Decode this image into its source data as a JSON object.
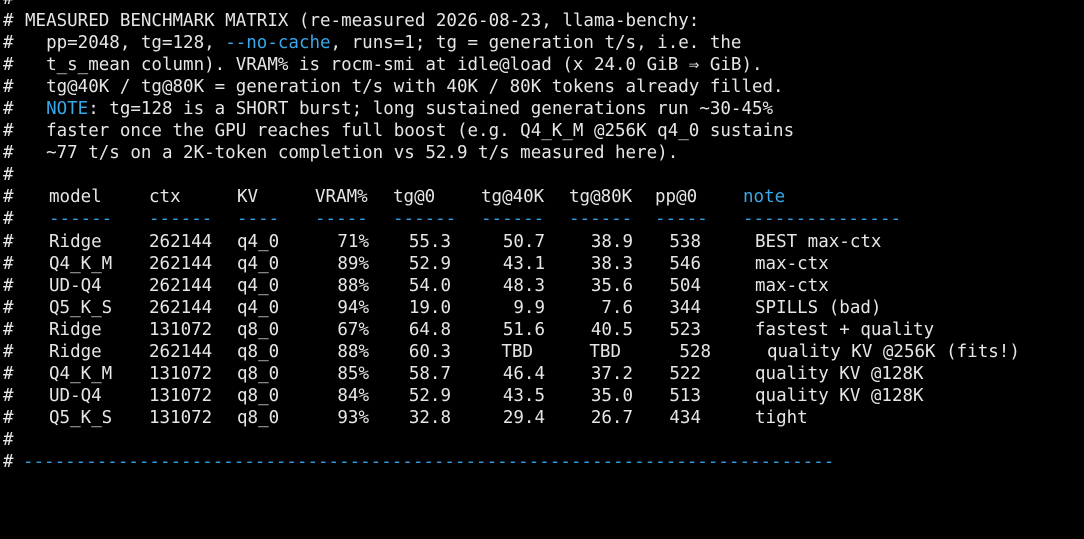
{
  "terminal": {
    "top_separator": "-----------------------------------------------------------------------------",
    "bottom_separator": "-----------------------------------------------------------------------------",
    "comment_char": "#",
    "header_lines": [
      [
        "MEASURED BENCHMARK MATRIX (re-measured 2026-08-23, llama-benchy:"
      ],
      [
        "  pp=2048, tg=128, ",
        "--no-cache",
        ", runs=1; tg = generation t/s, i.e. the"
      ],
      [
        "  t_s_mean column). VRAM% is rocm-smi at idle@load (x 24.0 GiB ⇒ GiB)."
      ],
      [
        "  tg@40K / tg@80K = generation t/s with 40K / 80K tokens already filled."
      ],
      [
        "  ",
        "NOTE",
        ": tg=128 is a SHORT burst; long sustained generations run ~30-45%"
      ],
      [
        "  faster once the GPU reaches full boost (e.g. Q4_K_M @256K q4_0 sustains"
      ],
      [
        "  ~77 t/s on a 2K-token completion vs 52.9 t/s measured here)."
      ]
    ],
    "columns": [
      "model",
      "ctx",
      "KV",
      "VRAM%",
      "tg@0",
      "tg@40K",
      "tg@80K",
      "pp@0",
      "note"
    ],
    "column_dashes": [
      "------",
      "------",
      "----",
      "-----",
      "------",
      "------",
      "------",
      "-----",
      "---------------"
    ],
    "rows": [
      [
        "Ridge",
        "262144",
        "q4_0",
        "71%",
        "55.3",
        "50.7",
        "38.9",
        "538",
        "BEST max-ctx"
      ],
      [
        "Q4_K_M",
        "262144",
        "q4_0",
        "89%",
        "52.9",
        "43.1",
        "38.3",
        "546",
        "max-ctx"
      ],
      [
        "UD-Q4",
        "262144",
        "q4_0",
        "88%",
        "54.0",
        "48.3",
        "35.6",
        "504",
        "max-ctx"
      ],
      [
        "Q5_K_S",
        "262144",
        "q4_0",
        "94%",
        "19.0",
        "9.9",
        "7.6",
        "344",
        "SPILLS (bad)"
      ],
      [
        "Ridge",
        "131072",
        "q8_0",
        "67%",
        "64.8",
        "51.6",
        "40.5",
        "523",
        "fastest + quality"
      ],
      [
        "Ridge",
        "262144",
        "q8_0",
        "88%",
        "60.3",
        "TBD",
        "TBD",
        "528",
        "quality KV @256K (fits!)"
      ],
      [
        "Q4_K_M",
        "131072",
        "q8_0",
        "85%",
        "58.7",
        "46.4",
        "37.2",
        "522",
        "quality KV @128K"
      ],
      [
        "UD-Q4",
        "131072",
        "q8_0",
        "84%",
        "52.9",
        "43.5",
        "35.0",
        "513",
        "quality KV @128K"
      ],
      [
        "Q5_K_S",
        "131072",
        "q8_0",
        "93%",
        "32.8",
        "29.4",
        "26.7",
        "434",
        "tight"
      ]
    ],
    "colors": {
      "background": "#000000",
      "text": "#e6e6e6",
      "accent_cyan": "#38a8e8",
      "separator_blue": "#2f9ee0"
    }
  }
}
